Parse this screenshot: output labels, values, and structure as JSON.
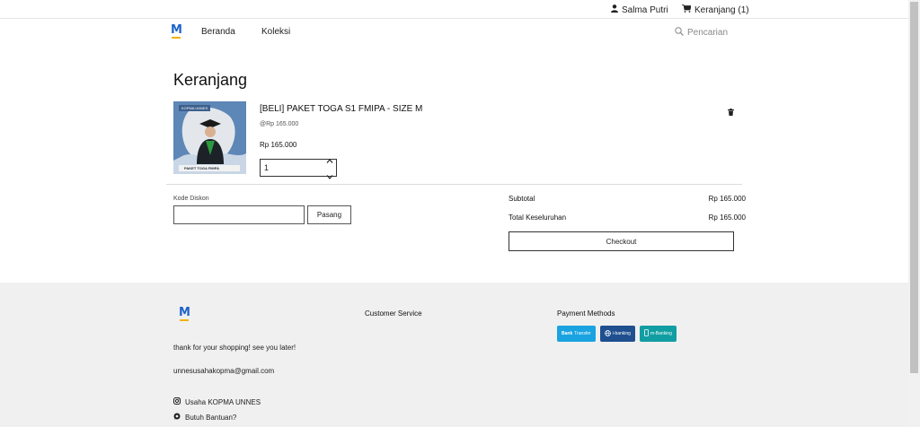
{
  "header": {
    "user_name": "Salma Putri",
    "cart_label": "Keranjang (1)"
  },
  "nav": {
    "logo_text": "M",
    "links": [
      "Beranda",
      "Koleksi"
    ],
    "search_placeholder": "Pencarian"
  },
  "page": {
    "title": "Keranjang"
  },
  "cart_item": {
    "image_tag": "KOPMA UNNES",
    "image_caption": "PAKET TOGA FMIPA",
    "name": "[BELI] PAKET TOGA S1 FMIPA - SIZE M",
    "unit_price": "@Rp 165.000",
    "price": "Rp 165.000",
    "quantity": "1"
  },
  "discount": {
    "label": "Kode Diskon",
    "value": "",
    "apply_label": "Pasang"
  },
  "summary": {
    "subtotal_label": "Subtotal",
    "subtotal_value": "Rp 165.000",
    "total_label": "Total Keseluruhan",
    "total_value": "Rp 165.000",
    "checkout_label": "Checkout"
  },
  "footer": {
    "logo_text": "M",
    "tagline": "thank for your shopping! see you later!",
    "email": "unnesusahakopma@gmail.com",
    "instagram": "Usaha KOPMA UNNES",
    "whatsapp": "Butuh Bantuan?",
    "customer_service_title": "Customer Service",
    "payment_title": "Payment Methods",
    "payment_methods": [
      {
        "bold": "Bank",
        "rest": "Transfer",
        "color": "#1aa3e0"
      },
      {
        "bold": "",
        "rest": "i-banking",
        "color": "#1f4f8f"
      },
      {
        "bold": "",
        "rest": "m-Banking",
        "color": "#119ea3"
      }
    ]
  },
  "colors": {
    "brand": "#1e63c9",
    "footer_bg": "#f0f0f0"
  }
}
